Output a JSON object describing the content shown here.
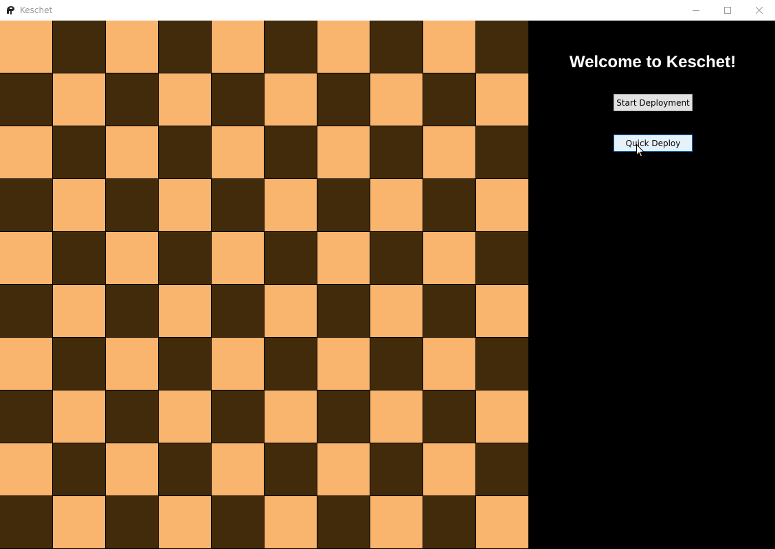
{
  "window": {
    "title": "Keschet",
    "app_icon": "spartan-helmet-icon",
    "controls": [
      "minimize-icon",
      "maximize-icon",
      "close-icon"
    ]
  },
  "board": {
    "rows": 10,
    "cols": 10,
    "light_color": "#f9b46e",
    "dark_color": "#412b0b",
    "top_left": "light"
  },
  "panel": {
    "welcome": "Welcome to Keschet!",
    "start_button": "Start Deployment",
    "quick_button": "Quick Deploy"
  }
}
